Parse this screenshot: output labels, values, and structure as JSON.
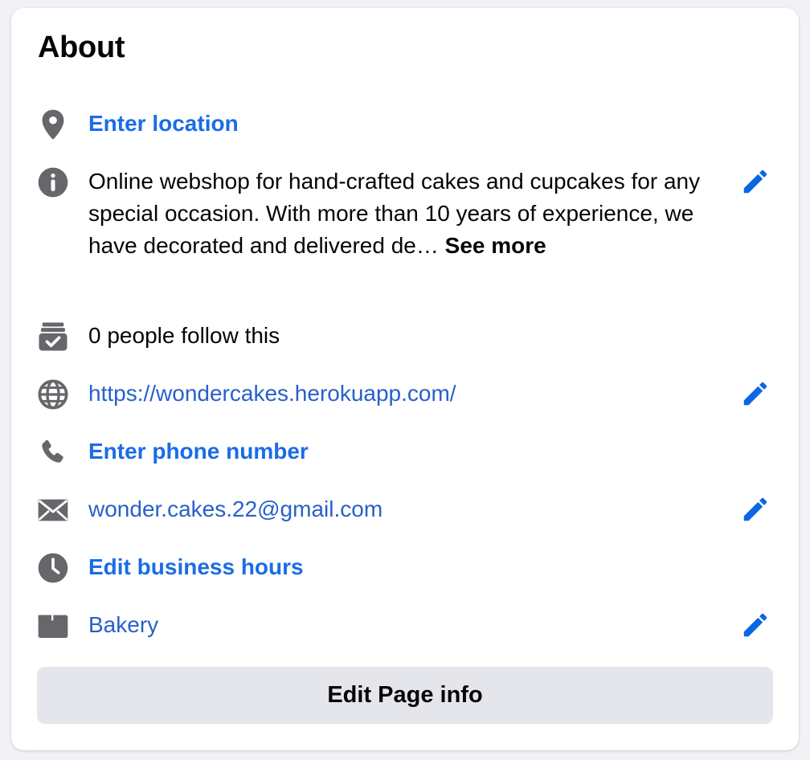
{
  "about": {
    "title": "About",
    "location": {
      "label": "Enter location",
      "icon": "location-pin-icon"
    },
    "description": {
      "text": "Online webshop for hand-crafted cakes and cupcakes for any special occasion. With more than 10 years of experience, we have decorated and delivered de…",
      "see_more": "See more",
      "icon": "info-icon"
    },
    "followers": {
      "label": "0 people follow this",
      "icon": "follow-icon"
    },
    "website": {
      "label": "https://wondercakes.herokuapp.com/",
      "icon": "globe-icon"
    },
    "phone": {
      "label": "Enter phone number",
      "icon": "phone-icon"
    },
    "email": {
      "label": "wonder.cakes.22@gmail.com",
      "icon": "mail-icon"
    },
    "hours": {
      "label": "Edit business hours",
      "icon": "clock-icon"
    },
    "category": {
      "label": "Bakery",
      "icon": "category-icon"
    },
    "edit_button": "Edit Page info"
  },
  "colors": {
    "background": "#f0f2f5",
    "card": "#ffffff",
    "icon_gray": "#65676b",
    "link_blue": "#1b6ce6",
    "pencil_blue": "#0a66e4",
    "button_gray": "#e4e6eb"
  }
}
